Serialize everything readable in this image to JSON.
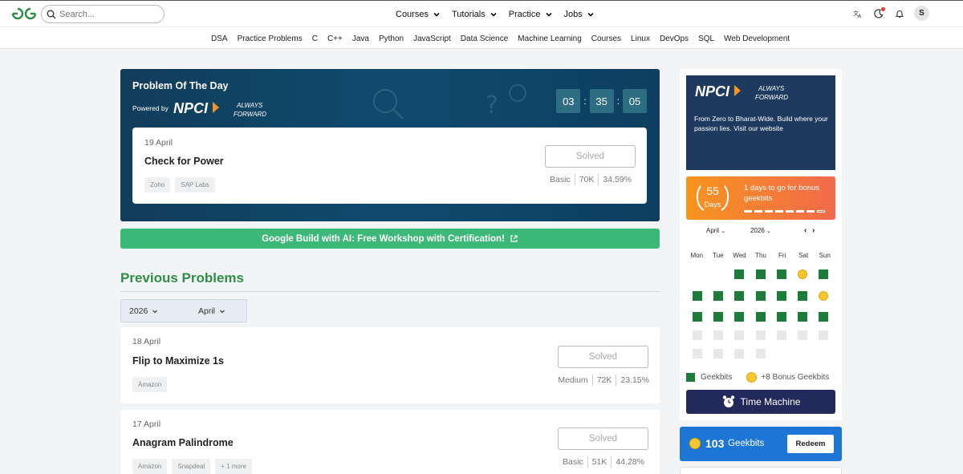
{
  "header": {
    "search_placeholder": "Search...",
    "nav": [
      {
        "label": "Courses"
      },
      {
        "label": "Tutorials"
      },
      {
        "label": "Practice"
      },
      {
        "label": "Jobs"
      }
    ],
    "avatar_letter": "S"
  },
  "subnav": [
    "DSA",
    "Practice Problems",
    "C",
    "C++",
    "Java",
    "Python",
    "JavaScript",
    "Data Science",
    "Machine Learning",
    "Courses",
    "Linux",
    "DevOps",
    "SQL",
    "Web Development"
  ],
  "potd": {
    "title": "Problem Of The Day",
    "powered_by": "Powered by",
    "timer": [
      "03",
      "35",
      "05"
    ],
    "date": "19 April",
    "problem": "Check for Power",
    "tags": [
      "Zoho",
      "SAP Labs"
    ],
    "status": "Solved",
    "difficulty": "Basic",
    "submissions": "70K",
    "accuracy": "34.59%"
  },
  "workshop": {
    "label": "Google Build with AI: Free Workshop with Certification!"
  },
  "previous": {
    "title": "Previous Problems",
    "year": "2026",
    "month": "April",
    "problems": [
      {
        "date": "18 April",
        "name": "Flip to Maximize 1s",
        "tags": [
          "Amazon"
        ],
        "status": "Solved",
        "difficulty": "Medium",
        "submissions": "72K",
        "accuracy": "23.15%"
      },
      {
        "date": "17 April",
        "name": "Anagram Palindrome",
        "tags": [
          "Amazon",
          "Snapdeal",
          "+ 1 more"
        ],
        "status": "Solved",
        "difficulty": "Basic",
        "submissions": "51K",
        "accuracy": "44.28%"
      }
    ]
  },
  "sidebar": {
    "ad": {
      "logo_text": "NPCI",
      "tagline": "ALWAYS FORWARD",
      "text": "From Zero to Bharat-Wide. Build where your passion lies. Visit our website"
    },
    "streak": {
      "days": "55",
      "days_label": "Days",
      "message": "1 days to go for bonus geekbits"
    },
    "calendar": {
      "month": "April",
      "year": "2026",
      "day_names": [
        "Mon",
        "Tue",
        "Wed",
        "Thu",
        "Fri",
        "Sat",
        "Sun"
      ]
    },
    "legend": {
      "geekbits": "Geekbits",
      "bonus": "+8 Bonus Geekbits"
    },
    "time_machine": "Time Machine"
  },
  "geekbits": {
    "count": "103",
    "label": "Geekbits",
    "redeem": "Redeem"
  }
}
